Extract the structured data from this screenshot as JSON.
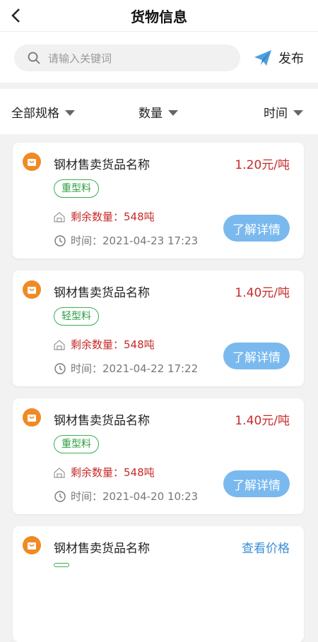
{
  "header": {
    "title": "货物信息",
    "back_icon": "chevron-left-icon"
  },
  "search": {
    "placeholder": "请输入关键词",
    "icon": "search-icon"
  },
  "publish": {
    "label": "发布",
    "icon": "paper-plane-icon"
  },
  "filters": [
    {
      "label": "全部规格"
    },
    {
      "label": "数量"
    },
    {
      "label": "时间"
    }
  ],
  "items": [
    {
      "name": "钢材售卖货品名称",
      "price": "1.20元/吨",
      "tag": "重型料",
      "qty": "剩余数量：548吨",
      "time": "时间：2021-04-23 17:23",
      "button": "了解详情"
    },
    {
      "name": "钢材售卖货品名称",
      "price": "1.40元/吨",
      "tag": "轻型料",
      "qty": "剩余数量：548吨",
      "time": "时间：2021-04-22 17:22",
      "button": "了解详情"
    },
    {
      "name": "钢材售卖货品名称",
      "price": "1.40元/吨",
      "tag": "重型料",
      "qty": "剩余数量：548吨",
      "time": "时间：2021-04-20 10:23",
      "button": "了解详情"
    },
    {
      "name": "钢材售卖货品名称",
      "price": "查看价格"
    }
  ],
  "colors": {
    "accent_orange": "#f08a24",
    "price_red": "#c62a2a",
    "tag_green": "#2e9e43",
    "button_blue": "#7ab9ee",
    "link_blue": "#3a8fd6"
  }
}
